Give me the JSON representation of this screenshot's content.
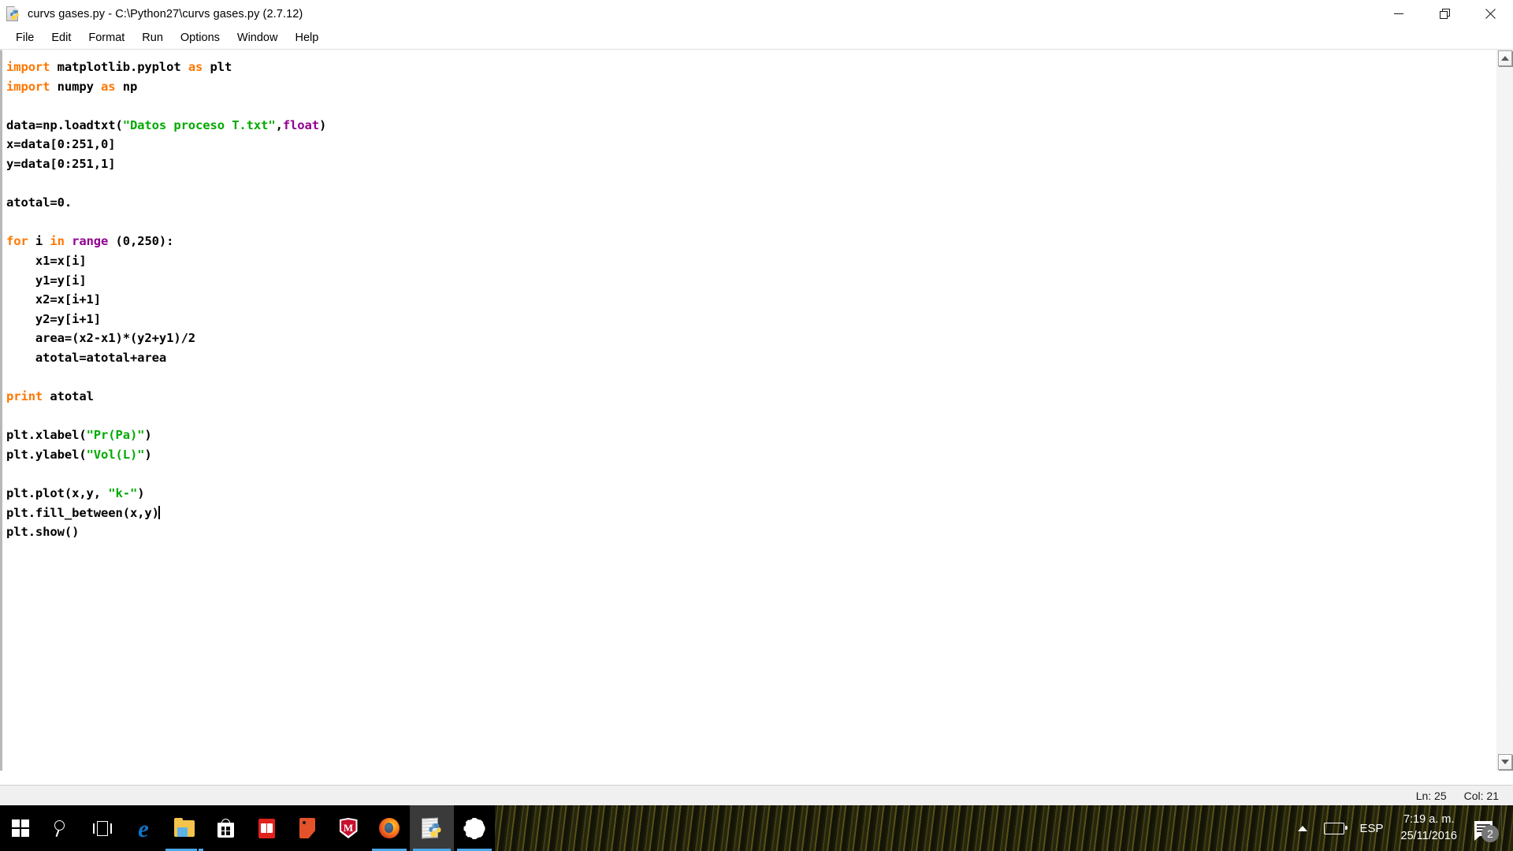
{
  "window": {
    "title": "curvs gases.py - C:\\Python27\\curvs gases.py (2.7.12)",
    "icon": "python-idle-document-icon",
    "controls": {
      "minimize": "minimize-icon",
      "maximize": "restore-icon",
      "close": "close-icon"
    }
  },
  "menubar": {
    "items": [
      {
        "label": "File"
      },
      {
        "label": "Edit"
      },
      {
        "label": "Format"
      },
      {
        "label": "Run"
      },
      {
        "label": "Options"
      },
      {
        "label": "Window"
      },
      {
        "label": "Help"
      }
    ]
  },
  "editor": {
    "language": "python",
    "caret_after_line": 25,
    "lines": [
      [
        {
          "t": "import",
          "c": "kw"
        },
        {
          "t": " matplotlib.pyplot ",
          "c": "pl"
        },
        {
          "t": "as",
          "c": "kw"
        },
        {
          "t": " plt",
          "c": "pl"
        }
      ],
      [
        {
          "t": "import",
          "c": "kw"
        },
        {
          "t": " numpy ",
          "c": "pl"
        },
        {
          "t": "as",
          "c": "kw"
        },
        {
          "t": " np",
          "c": "pl"
        }
      ],
      [],
      [
        {
          "t": "data=np.loadtxt(",
          "c": "pl"
        },
        {
          "t": "\"Datos proceso T.txt\"",
          "c": "str"
        },
        {
          "t": ",",
          "c": "pl"
        },
        {
          "t": "float",
          "c": "bi"
        },
        {
          "t": ")",
          "c": "pl"
        }
      ],
      [
        {
          "t": "x=data[0:251,0]",
          "c": "pl"
        }
      ],
      [
        {
          "t": "y=data[0:251,1]",
          "c": "pl"
        }
      ],
      [],
      [
        {
          "t": "atotal=0.",
          "c": "pl"
        }
      ],
      [],
      [
        {
          "t": "for",
          "c": "kw"
        },
        {
          "t": " i ",
          "c": "pl"
        },
        {
          "t": "in",
          "c": "kw"
        },
        {
          "t": " ",
          "c": "pl"
        },
        {
          "t": "range",
          "c": "bi"
        },
        {
          "t": " (0,250):",
          "c": "pl"
        }
      ],
      [
        {
          "t": "    x1=x[i]",
          "c": "pl"
        }
      ],
      [
        {
          "t": "    y1=y[i]",
          "c": "pl"
        }
      ],
      [
        {
          "t": "    x2=x[i+1]",
          "c": "pl"
        }
      ],
      [
        {
          "t": "    y2=y[i+1]",
          "c": "pl"
        }
      ],
      [
        {
          "t": "    area=(x2-x1)*(y2+y1)/2",
          "c": "pl"
        }
      ],
      [
        {
          "t": "    atotal=atotal+area",
          "c": "pl"
        }
      ],
      [],
      [
        {
          "t": "print",
          "c": "kw"
        },
        {
          "t": " atotal",
          "c": "pl"
        }
      ],
      [],
      [
        {
          "t": "plt.xlabel(",
          "c": "pl"
        },
        {
          "t": "\"Pr(Pa)\"",
          "c": "str"
        },
        {
          "t": ")",
          "c": "pl"
        }
      ],
      [
        {
          "t": "plt.ylabel(",
          "c": "pl"
        },
        {
          "t": "\"Vol(L)\"",
          "c": "str"
        },
        {
          "t": ")",
          "c": "pl"
        }
      ],
      [],
      [
        {
          "t": "plt.plot(x,y, ",
          "c": "pl"
        },
        {
          "t": "\"k-\"",
          "c": "str"
        },
        {
          "t": ")",
          "c": "pl"
        }
      ],
      [
        {
          "t": "plt.fill_between(x,y)",
          "c": "pl"
        },
        {
          "t": "CARET",
          "c": "caret"
        }
      ],
      [
        {
          "t": "plt.show()",
          "c": "pl"
        }
      ]
    ],
    "colors": {
      "keyword": "#ff7700",
      "string": "#00aa00",
      "builtin": "#900090",
      "plain": "#000000",
      "background": "#ffffff"
    }
  },
  "scrollbars": {
    "vertical": {
      "up": "scroll-up-arrow",
      "down": "scroll-down-arrow"
    },
    "horizontal": {
      "left": "scroll-left-arrow",
      "right": "scroll-right-arrow"
    }
  },
  "statusbar": {
    "line": "Ln: 25",
    "column": "Col: 21"
  },
  "taskbar": {
    "background": "#000000",
    "accent": "#4aa8e8",
    "items": [
      {
        "name": "start-button",
        "icon": "windows-logo-icon",
        "active": false,
        "underline": false
      },
      {
        "name": "search-button",
        "icon": "search-icon",
        "active": false,
        "underline": false
      },
      {
        "name": "task-view-button",
        "icon": "task-view-icon",
        "active": false,
        "underline": false
      },
      {
        "name": "edge-button",
        "icon": "edge-icon",
        "active": false,
        "underline": false
      },
      {
        "name": "file-explorer-button",
        "icon": "folder-icon",
        "active": false,
        "underline": true,
        "multi": true
      },
      {
        "name": "microsoft-store-button",
        "icon": "store-bag-icon",
        "active": false,
        "underline": false
      },
      {
        "name": "reader-button",
        "icon": "book-icon",
        "active": false,
        "underline": false
      },
      {
        "name": "orange-app-button",
        "icon": "flag-app-icon",
        "active": false,
        "underline": false
      },
      {
        "name": "mcafee-button",
        "icon": "shield-icon",
        "active": false,
        "underline": false
      },
      {
        "name": "firefox-button",
        "icon": "firefox-icon",
        "active": false,
        "underline": true
      },
      {
        "name": "python-idle-button",
        "icon": "python-idle-icon",
        "active": true,
        "underline": true
      },
      {
        "name": "settings-button",
        "icon": "gear-icon",
        "active": false,
        "underline": true
      }
    ],
    "tray": {
      "overflow": "chevron-up-icon",
      "battery": "battery-icon",
      "language": "ESP",
      "time": "7:19 a. m.",
      "date": "25/11/2016",
      "notifications_icon": "notification-flag-icon",
      "notifications_count": "2"
    }
  }
}
